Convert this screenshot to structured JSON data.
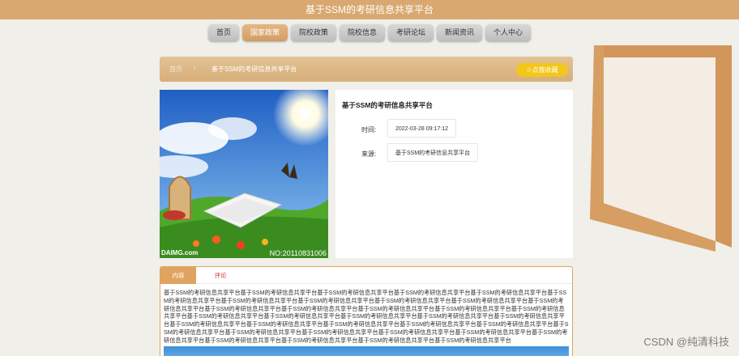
{
  "header": {
    "title": "基于SSM的考研信息共享平台"
  },
  "nav": {
    "items": [
      "首页",
      "国家政策",
      "院校政策",
      "院校信息",
      "考研论坛",
      "新闻资讯",
      "个人中心"
    ],
    "active": "国家政策"
  },
  "breadcrumb": {
    "home": "首页",
    "sep": "/",
    "current": "基于SSM的考研信息共享平台"
  },
  "favorite_label": "☆点我收藏",
  "hero": {
    "watermark_left": "DAIMG.com",
    "watermark_right": "NO:20110831006"
  },
  "detail": {
    "title": "基于SSM的考研信息共享平台",
    "time_label": "时间:",
    "time_value": "2022-03-28 09:17:12",
    "source_label": "来源:",
    "source_value": "基于SSM的考研信息共享平台"
  },
  "tabs": {
    "content": "内容",
    "comment": "评论"
  },
  "content_text": "基于SSM的考研信息共享平台基于SSM的考研信息共享平台基于SSM的考研信息共享平台基于SSM的考研信息共享平台基于SSM的考研信息共享平台基于SSM的考研信息共享平台基于SSM的考研信息共享平台基于SSM的考研信息共享平台基于SSM的考研信息共享平台基于SSM的考研信息共享平台基于SSM的考研信息共享平台基于SSM的考研信息共享平台基于SSM的考研信息共享平台基于SSM的考研信息共享平台基于SSM的考研信息共享平台基于SSM的考研信息共享平台基于SSM的考研信息共享平台基于SSM的考研信息共享平台基于SSM的考研信息共享平台基于SSM的考研信息共享平台基于SSM的考研信息共享平台基于SSM的考研信息共享平台基于SSM的考研信息共享平台基于SSM的考研信息共享平台基于SSM的考研信息共享平台基于SSM的考研信息共享平台基于SSM的考研信息共享平台基于SSM的考研信息共享平台基于SSM的考研信息共享平台基于SSM的考研信息共享平台基于SSM的考研信息共享平台基于SSM的考研信息共享平台基于SSM的考研信息共享平台基于SSM的考研信息共享平台基于SSM的考研信息共享平台基于SSM的考研信息共享平台",
  "watermark": "CSDN @纯清科技"
}
